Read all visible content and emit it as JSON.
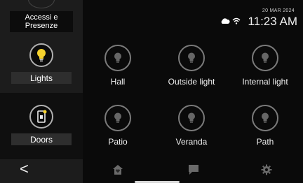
{
  "sidebar": {
    "top_label": "Accessi e Presenze",
    "items": [
      {
        "label": "Lights",
        "icon": "lightbulb-icon",
        "selected": true
      },
      {
        "label": "Doors",
        "icon": "door-lock-icon",
        "selected": false
      }
    ],
    "back_label": "<"
  },
  "header": {
    "date": "20 MAR 2024",
    "time": "11:23 AM",
    "status_icons": [
      "cloud-icon",
      "wifi-icon"
    ]
  },
  "lights": [
    {
      "label": "Hall"
    },
    {
      "label": "Outside light"
    },
    {
      "label": "Internal light"
    },
    {
      "label": "Patio"
    },
    {
      "label": "Veranda"
    },
    {
      "label": "Path"
    }
  ],
  "bottom_nav": [
    "home-icon",
    "chat-icon",
    "settings-icon"
  ],
  "colors": {
    "accent_yellow": "#f5d22e",
    "background": "#0a0a0a",
    "sidebar": "#1c1c1c"
  }
}
